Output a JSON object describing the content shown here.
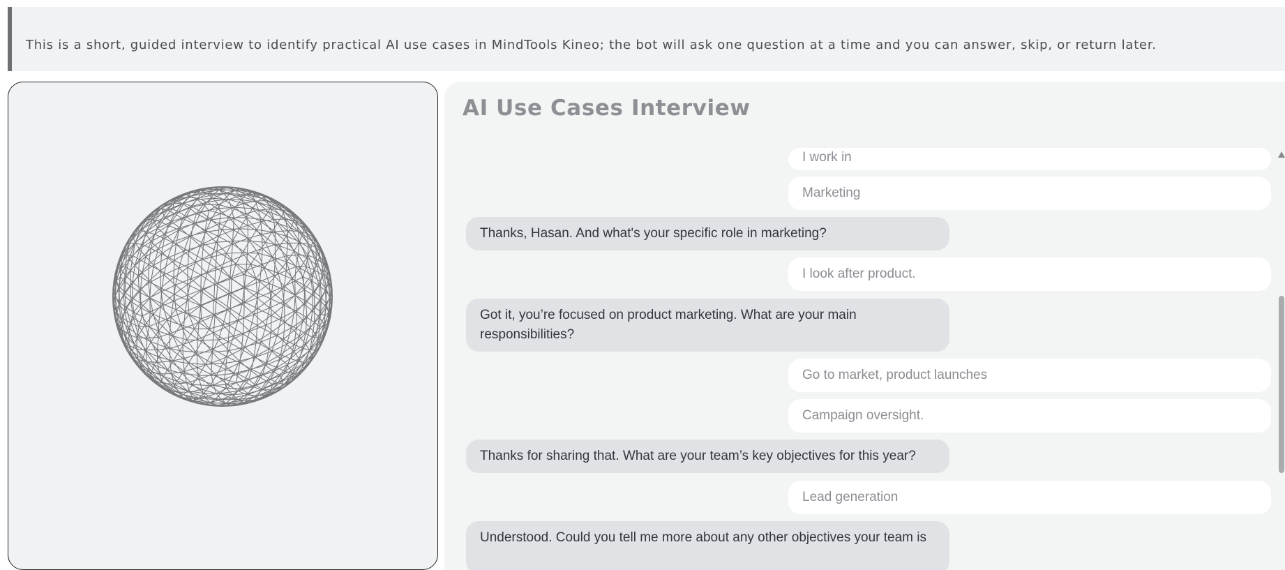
{
  "intro": {
    "text": "This is a short, guided interview to identify practical AI use cases in MindTools Kineo; the bot will ask one question at a time and you can answer, skip, or return later."
  },
  "visualizer": {
    "icon": "wireframe-sphere-icon",
    "stroke_color": "#77797c"
  },
  "chat": {
    "title": "AI Use Cases Interview",
    "messages": [
      {
        "role": "user",
        "text": "I work in"
      },
      {
        "role": "user",
        "text": "Marketing"
      },
      {
        "role": "bot",
        "text": "Thanks, Hasan. And what's your specific role in marketing?"
      },
      {
        "role": "user",
        "text": "I look after product."
      },
      {
        "role": "bot",
        "text": "Got it, you’re focused on product marketing. What are your main responsibilities?"
      },
      {
        "role": "user",
        "text": "Go to market, product launches"
      },
      {
        "role": "user",
        "text": "Campaign oversight."
      },
      {
        "role": "bot",
        "text": "Thanks for sharing that. What are your team’s key objectives for this year?"
      },
      {
        "role": "user",
        "text": "Lead generation"
      },
      {
        "role": "bot",
        "text": "Understood. Could you tell me more about any other objectives your team is"
      }
    ]
  },
  "colors": {
    "bot_bubble": "#e0e2e6",
    "user_bubble": "#ffffff",
    "title": "#8d8f94"
  }
}
